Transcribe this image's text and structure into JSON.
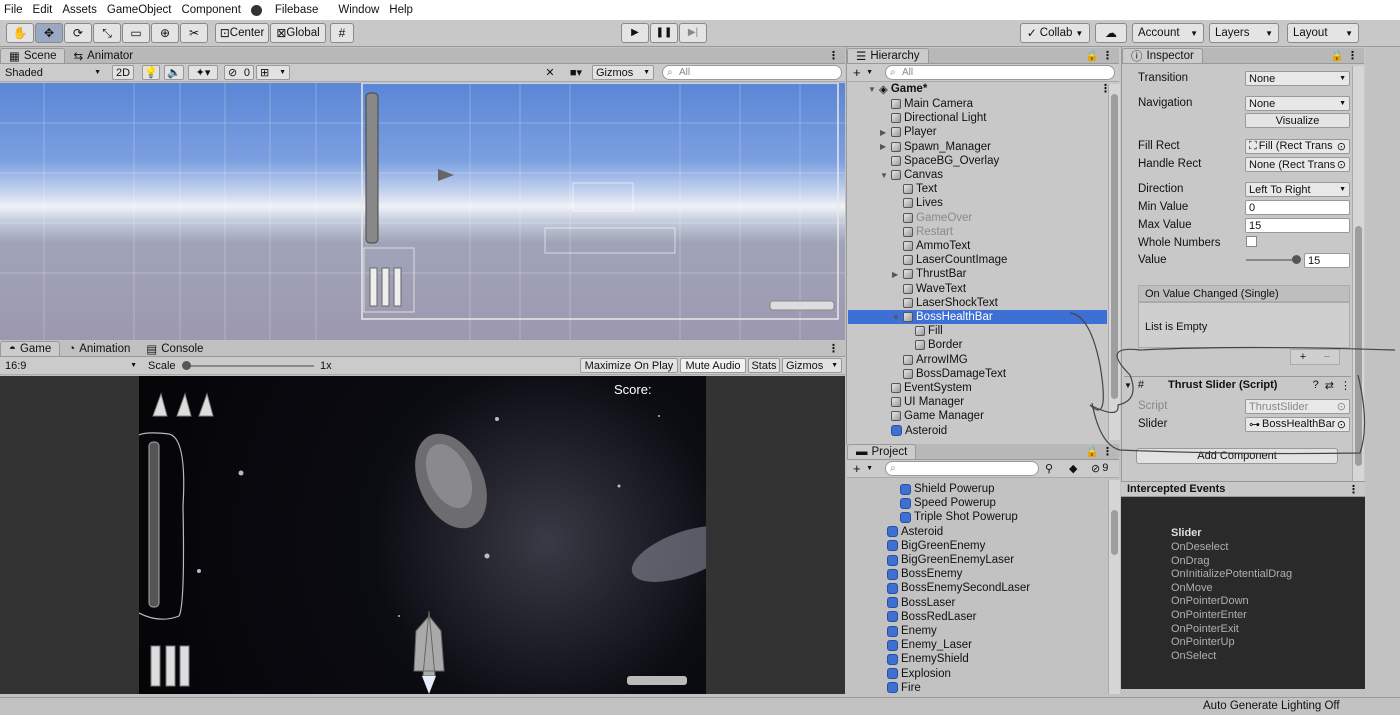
{
  "menu": [
    "File",
    "Edit",
    "Assets",
    "GameObject",
    "Component",
    "Filebase",
    "Window",
    "Help"
  ],
  "toolbar": {
    "pivot_label": "Center",
    "space_label": "Global",
    "collab_label": "Collab",
    "account_label": "Account",
    "layers_label": "Layers",
    "layout_label": "Layout"
  },
  "scene_panel": {
    "tabs": [
      "Scene",
      "Animator"
    ],
    "shading": "Shaded",
    "mode_2d": "2D",
    "hidden_count": "0",
    "gizmos": "Gizmos",
    "search_placeholder": "All"
  },
  "game_panel": {
    "tabs": [
      "Game",
      "Animation",
      "Console"
    ],
    "aspect": "16:9",
    "scale_label": "Scale",
    "scale_value": "1x",
    "buttons": [
      "Maximize On Play",
      "Mute Audio",
      "Stats",
      "Gizmos"
    ],
    "score_text": "Score:"
  },
  "hierarchy": {
    "title": "Hierarchy",
    "search_placeholder": "All",
    "scene_name": "Game*",
    "items": [
      {
        "label": "Main Camera",
        "depth": 1,
        "arrow": ""
      },
      {
        "label": "Directional Light",
        "depth": 1,
        "arrow": ""
      },
      {
        "label": "Player",
        "depth": 1,
        "arrow": "▶"
      },
      {
        "label": "Spawn_Manager",
        "depth": 1,
        "arrow": "▶"
      },
      {
        "label": "SpaceBG_Overlay",
        "depth": 1,
        "arrow": ""
      },
      {
        "label": "Canvas",
        "depth": 1,
        "arrow": "▼"
      },
      {
        "label": "Text",
        "depth": 2,
        "arrow": ""
      },
      {
        "label": "Lives",
        "depth": 2,
        "arrow": ""
      },
      {
        "label": "GameOver",
        "depth": 2,
        "arrow": "",
        "dim": true
      },
      {
        "label": "Restart",
        "depth": 2,
        "arrow": "",
        "dim": true
      },
      {
        "label": "AmmoText",
        "depth": 2,
        "arrow": ""
      },
      {
        "label": "LaserCountImage",
        "depth": 2,
        "arrow": ""
      },
      {
        "label": "ThrustBar",
        "depth": 2,
        "arrow": "▶"
      },
      {
        "label": "WaveText",
        "depth": 2,
        "arrow": ""
      },
      {
        "label": "LaserShockText",
        "depth": 2,
        "arrow": ""
      },
      {
        "label": "BossHealthBar",
        "depth": 2,
        "arrow": "▼",
        "selected": true
      },
      {
        "label": "Fill",
        "depth": 3,
        "arrow": ""
      },
      {
        "label": "Border",
        "depth": 3,
        "arrow": ""
      },
      {
        "label": "ArrowIMG",
        "depth": 2,
        "arrow": ""
      },
      {
        "label": "BossDamageText",
        "depth": 2,
        "arrow": ""
      },
      {
        "label": "EventSystem",
        "depth": 1,
        "arrow": ""
      },
      {
        "label": "UI Manager",
        "depth": 1,
        "arrow": ""
      },
      {
        "label": "Game Manager",
        "depth": 1,
        "arrow": ""
      },
      {
        "label": "Asteroid",
        "depth": 1,
        "arrow": "",
        "prefab": true
      }
    ]
  },
  "project": {
    "title": "Project",
    "hidden_count": "9",
    "items": [
      {
        "label": "Shield Powerup",
        "depth": 1
      },
      {
        "label": "Speed Powerup",
        "depth": 1
      },
      {
        "label": "Triple Shot Powerup",
        "depth": 1
      },
      {
        "label": "Asteroid",
        "depth": 0
      },
      {
        "label": "BigGreenEnemy",
        "depth": 0
      },
      {
        "label": "BigGreenEnemyLaser",
        "depth": 0
      },
      {
        "label": "BossEnemy",
        "depth": 0
      },
      {
        "label": "BossEnemySecondLaser",
        "depth": 0
      },
      {
        "label": "BossLaser",
        "depth": 0
      },
      {
        "label": "BossRedLaser",
        "depth": 0
      },
      {
        "label": "Enemy",
        "depth": 0
      },
      {
        "label": "Enemy_Laser",
        "depth": 0
      },
      {
        "label": "EnemyShield",
        "depth": 0
      },
      {
        "label": "Explosion",
        "depth": 0
      },
      {
        "label": "Fire",
        "depth": 0
      }
    ]
  },
  "inspector": {
    "title": "Inspector",
    "transition_label": "Transition",
    "transition_value": "None",
    "navigation_label": "Navigation",
    "navigation_value": "None",
    "visualize_label": "Visualize",
    "fill_rect_label": "Fill Rect",
    "fill_rect_value": "Fill (Rect Trans",
    "handle_rect_label": "Handle Rect",
    "handle_rect_value": "None (Rect Trans",
    "direction_label": "Direction",
    "direction_value": "Left To Right",
    "min_label": "Min Value",
    "min_value": "0",
    "max_label": "Max Value",
    "max_value": "15",
    "whole_label": "Whole Numbers",
    "value_label": "Value",
    "value_value": "15",
    "event_header": "On Value Changed (Single)",
    "event_empty": "List is Empty",
    "component_title": "Thrust Slider (Script)",
    "script_label": "Script",
    "script_value": "ThrustSlider",
    "slider_label": "Slider",
    "slider_value": "BossHealthBar",
    "add_component": "Add Component"
  },
  "intercepted": {
    "title": "Intercepted Events",
    "heading": "Slider",
    "events": [
      "OnDeselect",
      "OnDrag",
      "OnInitializePotentialDrag",
      "OnMove",
      "OnPointerDown",
      "OnPointerEnter",
      "OnPointerExit",
      "OnPointerUp",
      "OnSelect"
    ]
  },
  "status": {
    "lighting": "Auto Generate Lighting Off"
  }
}
